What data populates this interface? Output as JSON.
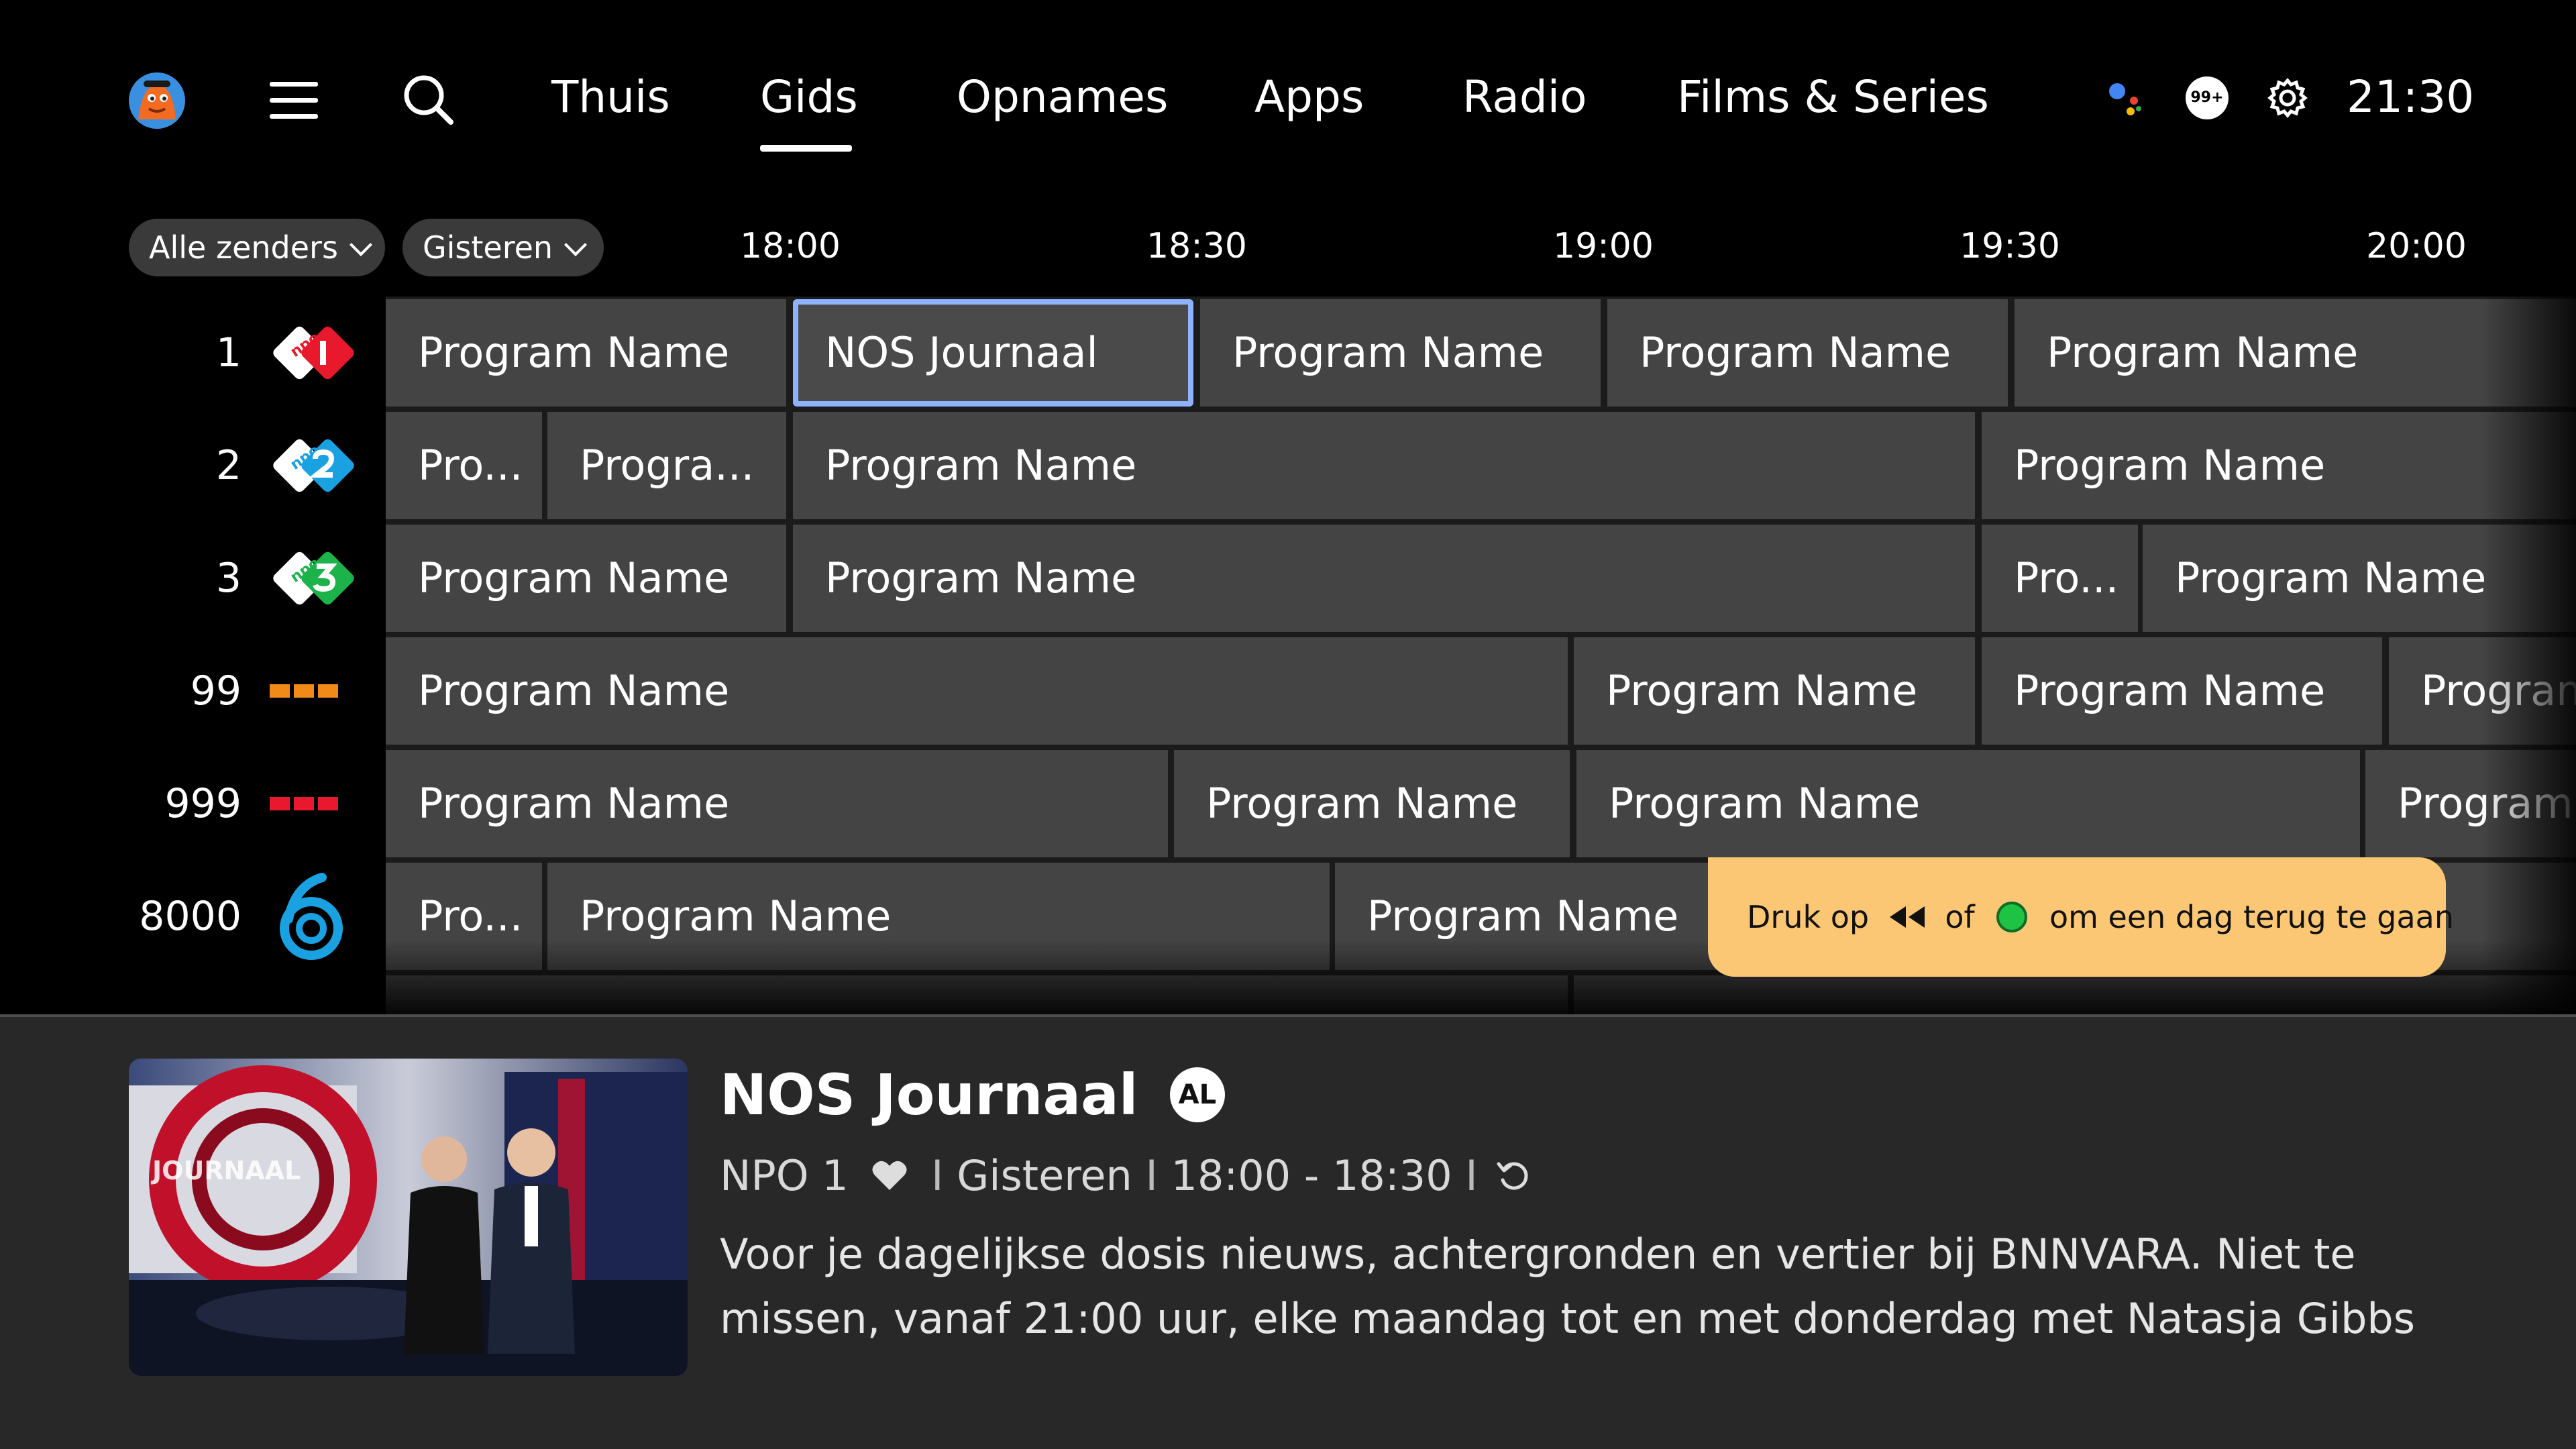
{
  "nav": {
    "items": [
      "Thuis",
      "Gids",
      "Opnames",
      "Apps",
      "Radio",
      "Films & Series"
    ],
    "active": "Gids",
    "notifications_badge": "99+",
    "clock": "21:30"
  },
  "filters": {
    "channels_label": "Alle zenders",
    "day_label": "Gisteren"
  },
  "timeline": [
    "18:00",
    "18:30",
    "19:00",
    "19:30",
    "20:00"
  ],
  "channels": [
    {
      "number": "1",
      "logo": "npo-1-logo",
      "programs": [
        "Program Name",
        "NOS Journaal",
        "Program Name",
        "Program Name",
        "Program Name"
      ]
    },
    {
      "number": "2",
      "logo": "npo-2-logo",
      "programs": [
        "Pro...",
        "Progra...",
        "Program Name",
        "Program Name"
      ]
    },
    {
      "number": "3",
      "logo": "npo-3-logo",
      "programs": [
        "Program Name",
        "Program Name",
        "Pro...",
        "Program Name"
      ]
    },
    {
      "number": "99",
      "logo": "rtl-logo-orange",
      "programs": [
        "Program Name",
        "Program Name",
        "Program Name",
        "Program Name"
      ]
    },
    {
      "number": "999",
      "logo": "rtl-logo-red",
      "programs": [
        "Program Name",
        "Program Name",
        "Program Name",
        "Program Name"
      ]
    },
    {
      "number": "8000",
      "logo": "channel-6-logo",
      "programs": [
        "Pro...",
        "Program Name",
        "Program Name"
      ]
    }
  ],
  "toast": {
    "prefix": "Druk op",
    "middle": "of",
    "suffix": "om een dag terug te gaan"
  },
  "details": {
    "title": "NOS Journaal",
    "rating_badge": "AL",
    "channel": "NPO 1",
    "day": "Gisteren",
    "time": "18:00 - 18:30",
    "thumb_text": "JOURNAAL",
    "description": "Voor je dagelijkse dosis nieuws, achtergronden en vertier bij BNNVARA. Niet te missen, vanaf 21:00 uur, elke maandag tot en met donderdag met Natasja Gibbs en op de"
  },
  "colors": {
    "focus_outline": "#8fb2ff",
    "toast_bg": "#fcc775",
    "npo_red": "#e8192c",
    "npo2_blue": "#1aa1e1",
    "npo3_green": "#1bb34a",
    "rtl_orange": "#f28a1a"
  }
}
